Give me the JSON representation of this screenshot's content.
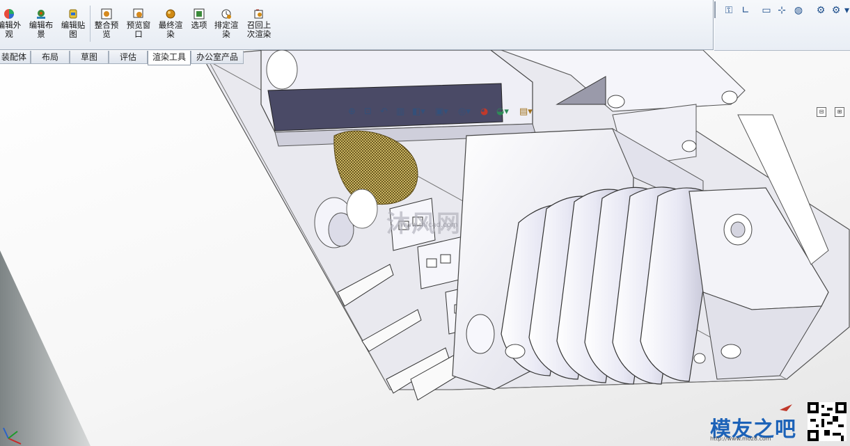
{
  "ribbon": {
    "buttons": [
      {
        "label": "编辑外\n观",
        "icon": "edit-appearance-icon"
      },
      {
        "label": "编辑布\n景",
        "icon": "edit-scene-icon"
      },
      {
        "label": "编辑贴\n图",
        "icon": "edit-decal-icon"
      },
      {
        "label": "整合预\n览",
        "icon": "integrated-preview-icon"
      },
      {
        "label": "预览窗\n口",
        "icon": "preview-window-icon"
      },
      {
        "label": "最终渲\n染",
        "icon": "final-render-icon"
      },
      {
        "label": "选项",
        "icon": "options-icon"
      },
      {
        "label": "排定渲\n染",
        "icon": "schedule-render-icon"
      },
      {
        "label": "召回上\n次渲染",
        "icon": "recall-last-render-icon"
      }
    ]
  },
  "tabs": [
    "装配体",
    "布局",
    "草图",
    "评估",
    "渲染工具",
    "办公室产品"
  ],
  "active_tab": "渲染工具",
  "watermarks": {
    "center": "沐风网",
    "center_url": "www.mfcad.com",
    "brand": "模友之吧",
    "brand_url": "http://www.moz8.com"
  },
  "colors": {
    "ribbon_bg": "#eef2f7",
    "tab_border": "#a5afbc",
    "model_white": "#f4f4fa",
    "model_shadow": "#a8a8b8",
    "accent_blue": "#1e4f8c",
    "brand_blue": "#1c62b8"
  }
}
